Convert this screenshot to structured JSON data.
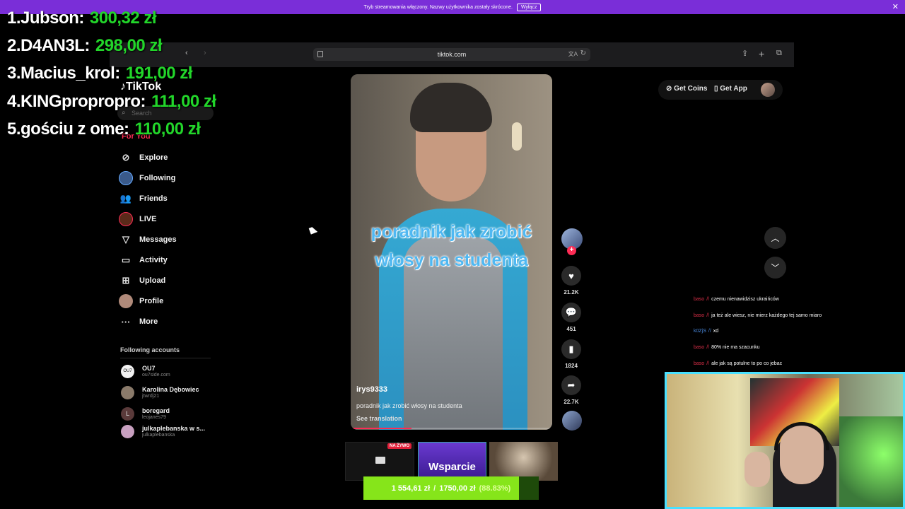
{
  "banner": {
    "text": "Tryb streamowania włączony. Nazwy użytkownika zostały skrócone.",
    "button": "Wyłącz",
    "close": "✕"
  },
  "leaderboard": [
    {
      "rank": "1.",
      "name": "Jubson:",
      "amount": "300,32 zł"
    },
    {
      "rank": "2.",
      "name": "D4AN3L:",
      "amount": "298,00 zł"
    },
    {
      "rank": "3.",
      "name": "Macius_krol:",
      "amount": "191,00 zł"
    },
    {
      "rank": "4.",
      "name": "KINGpropropro:",
      "amount": "111,00 zł"
    },
    {
      "rank": "5.",
      "name": "gościu z ome:",
      "amount": "110,00 zł"
    }
  ],
  "browser": {
    "url": "tiktok.com",
    "icons": [
      "back-icon",
      "forward-icon",
      "share-icon",
      "new-tab-icon",
      "tabs-icon",
      "reload-icon",
      "translate-icon"
    ]
  },
  "tiktok": {
    "logo": "TikTok",
    "search_placeholder": "Search",
    "for_you": "For You",
    "nav": [
      {
        "label": "Explore",
        "icon": "compass-icon"
      },
      {
        "label": "Following",
        "icon": "following-avatar-icon"
      },
      {
        "label": "Friends",
        "icon": "friends-icon"
      },
      {
        "label": "LIVE",
        "icon": "live-icon"
      },
      {
        "label": "Messages",
        "icon": "messages-icon"
      },
      {
        "label": "Activity",
        "icon": "activity-icon"
      },
      {
        "label": "Upload",
        "icon": "upload-icon"
      },
      {
        "label": "Profile",
        "icon": "profile-avatar-icon"
      },
      {
        "label": "More",
        "icon": "more-icon"
      }
    ],
    "following_title": "Following accounts",
    "accounts": [
      {
        "name": "OU7",
        "handle": "ou7side.com",
        "avatar": "OU7",
        "color": "#f2f2f2"
      },
      {
        "name": "Karolina Dębowiec",
        "handle": "jtwrdj21",
        "avatar": "",
        "color": "#8a7a6a"
      },
      {
        "name": "boregard",
        "handle": "leojanes79",
        "avatar": "L",
        "color": "#5a3a3a"
      },
      {
        "name": "julkaplebanska w s...",
        "handle": "julkaplebanska",
        "avatar": "",
        "color": "#c8a0c0"
      }
    ],
    "get_coins": "Get Coins",
    "get_app": "Get App"
  },
  "video": {
    "caption": "poradnik jak zrobić włosy na studenta",
    "author": "irys9333",
    "description": "poradnik jak zrobić włosy na studenta",
    "see_translation": "See translation",
    "progress_pct": 30,
    "likes": "21.2K",
    "comments": "451",
    "saves": "1824",
    "shares": "22.7K"
  },
  "chat": [
    {
      "user": "baso",
      "sep": "//",
      "msg": "czemu nienawidzisz ukraińców",
      "color": "#e0304a"
    },
    {
      "user": "baso",
      "sep": "//",
      "msg": "ja też ale wiesz, nie mierz każdego tej samo miaro",
      "color": "#e0304a"
    },
    {
      "user": "k0ZjS",
      "sep": "//",
      "msg": "xd",
      "color": "#4a8ae0"
    },
    {
      "user": "baso",
      "sep": "//",
      "msg": "80% nie ma szacunku",
      "color": "#e0304a"
    },
    {
      "user": "baso",
      "sep": "//",
      "msg": "ale jak są potulne to po co jebac",
      "color": "#e0304a"
    }
  ],
  "thumbs": {
    "live": "NA ŻYWO",
    "support": "Wsparcie"
  },
  "goal": {
    "current": "1 554,61 zł",
    "separator": "/",
    "target": "1750,00 zł",
    "percent": "(88.83%)",
    "fraction": 0.8883
  }
}
